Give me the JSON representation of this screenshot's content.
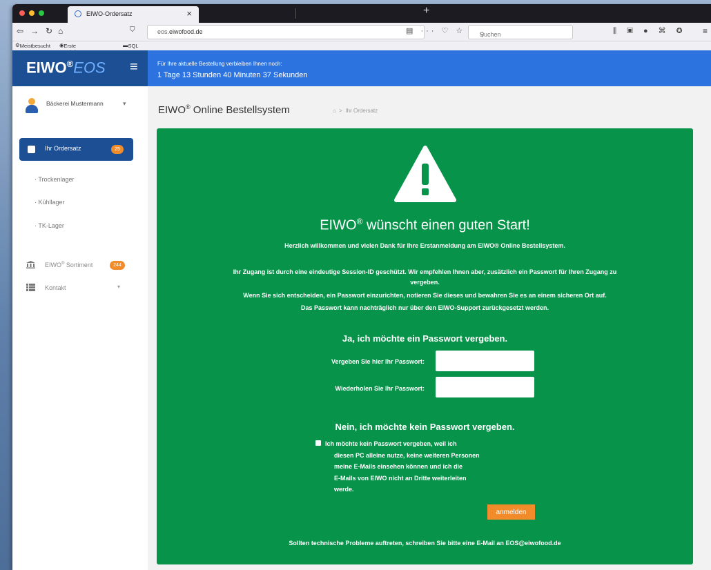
{
  "browser": {
    "tab_title": "EIWO-Ordersatz",
    "tab_close": "×",
    "new_tab": "+",
    "url_prefix": "eos.",
    "url_domain": "eiwofood.de",
    "search_placeholder": "Suchen",
    "bookmarks": [
      "Meistbesucht",
      "Erste Schritte",
      "SQL"
    ]
  },
  "header": {
    "logo_main": "EIWO",
    "logo_reg": "®",
    "logo_sub": "EOS",
    "timer_label": "Für Ihre aktuelle Bestellung verbleiben Ihnen noch:",
    "timer_value": "1 Tage 13 Stunden 40 Minuten 37 Sekunden"
  },
  "sidebar": {
    "user_name": "Bäckerei Mustermann",
    "active_item": {
      "label": "Ihr Ordersatz",
      "badge": "25"
    },
    "sub_items": [
      "Trockenlager",
      "Kühllager",
      "TK-Lager"
    ],
    "sortiment": {
      "label_main": "EIWO",
      "label_reg": "®",
      "label_rest": " Sortiment",
      "badge": "244"
    },
    "kontakt": {
      "label": "Kontakt"
    }
  },
  "main": {
    "title_main": "EIWO",
    "title_reg": "®",
    "title_rest": " Online Bestellsystem",
    "breadcrumb_current": "Ihr Ordersatz",
    "panel": {
      "heading_main": "EIWO",
      "heading_reg": "®",
      "heading_rest": " wünscht einen guten Start!",
      "welcome": "Herzlich willkommen und vielen Dank für Ihre Erstanmeldung am EIWO® Online Bestellsystem.",
      "info_lines": [
        "Ihr Zugang ist durch eine eindeutige Session-ID geschützt. Wir empfehlen Ihnen aber, zusätzlich ein Passwort für Ihren Zugang zu",
        "vergeben.",
        "Wenn Sie sich entscheiden, ein Passwort einzurichten, notieren Sie dieses und bewahren Sie es an einem sicheren Ort auf.",
        "Das Passwort kann nachträglich nur über den EIWO-Support zurückgesetzt werden."
      ],
      "yes_title": "Ja, ich möchte ein Passwort vergeben.",
      "password_label": "Vergeben Sie hier Ihr Passwort:",
      "password_value": "",
      "repeat_label": "Wiederholen Sie Ihr Passwort:",
      "repeat_value": "",
      "no_title": "Nein, ich möchte kein Passwort vergeben.",
      "no_lines": [
        "Ich möchte kein Passwort vergeben, weil ich",
        "diesen PC alleine nutze, keine weiteren Personen",
        "meine E-Mails einsehen können und ich die",
        "E-Mails von EIWO nicht an Dritte weiterleiten",
        "werde."
      ],
      "no_checked": false,
      "submit_label": "anmelden",
      "footer": "Sollten technische Probleme auftreten, schreiben Sie bitte eine E-Mail an EOS@eiwofood.de"
    }
  },
  "colors": {
    "header_dark": "#1d4f95",
    "header_blue": "#2d73e0",
    "panel_green": "#07934a",
    "badge_orange": "#f28c2a"
  }
}
